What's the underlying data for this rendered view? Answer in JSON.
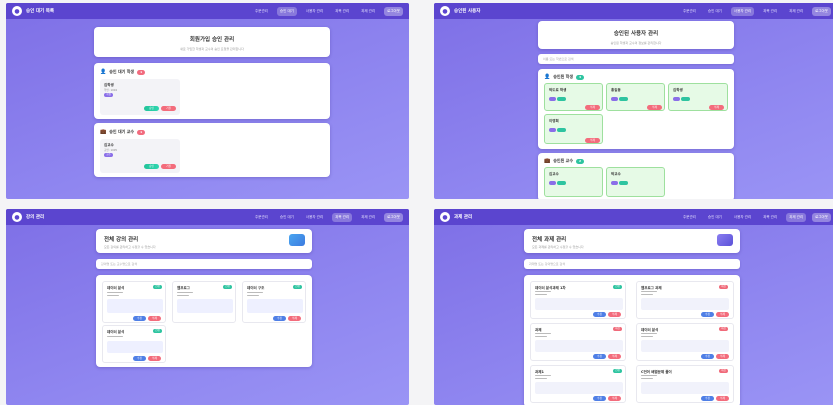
{
  "screens": [
    {
      "brand": "승인 대기 목록",
      "nav": [
        "주문관리",
        "승인 대기",
        "사용자 관리",
        "과목 관리",
        "과제 관리",
        "로그아웃"
      ],
      "active": 1,
      "title": "회원가입 승인 관리",
      "subtitle": "새로 가입한 학생과 교수의 승인 요청을 관리합니다",
      "students_title": "승인 대기 학생",
      "students_count": "1",
      "student_name": "김학생",
      "student_id": "학번: 1004",
      "professors_title": "승인 대기 교수",
      "professors_count": "1",
      "professor_name": "김교수",
      "professor_id": "교번: 1005",
      "role_student": "학생",
      "role_professor": "교수",
      "approve": "승인",
      "reject": "거절"
    },
    {
      "brand": "승인된 사용자",
      "nav": [
        "주문관리",
        "승인 대기",
        "사용자 관리",
        "과목 관리",
        "과제 관리",
        "로그아웃"
      ],
      "active": 2,
      "title": "승인된 사용자 관리",
      "subtitle": "승인된 학생과 교수의 정보를 관리합니다",
      "search_placeholder": "이름 또는 학번으로 검색",
      "students_title": "승인된 학생",
      "students_count": "4",
      "students": [
        "박도로 학생",
        "홍길동",
        "김학생",
        "이영희"
      ],
      "professors_title": "승인된 교수",
      "professors_count": "2",
      "professors": [
        "김교수",
        "박교수"
      ],
      "delete": "삭제"
    },
    {
      "brand": "강의 관리",
      "nav": [
        "주문관리",
        "승인 대기",
        "사용자 관리",
        "과목 관리",
        "과제 관리",
        "로그아웃"
      ],
      "active": 3,
      "title": "전체 강의 관리",
      "subtitle": "모든 강의를 관리하고 수정할 수 있습니다",
      "search_placeholder": "강의명 또는 교수명으로 검색",
      "courses": [
        "데이터 분석",
        "웹프로그",
        "데이터 구조",
        "데이터 분석"
      ],
      "status": "진행",
      "edit": "수정",
      "delete": "삭제"
    },
    {
      "brand": "과제 관리",
      "nav": [
        "주문관리",
        "승인 대기",
        "사용자 관리",
        "과목 관리",
        "과제 관리",
        "로그아웃"
      ],
      "active": 4,
      "title": "전체 과제 관리",
      "subtitle": "모든 과제를 관리하고 수정할 수 있습니다",
      "search_placeholder": "과제명 또는 강의명으로 검색",
      "assignments": [
        "데이터 분석과제 1차",
        "웹프로그 과제",
        "과제",
        "데이터 분석",
        "과제1",
        "C언어 배열문제 풀이"
      ],
      "status_open": "진행",
      "status_closed": "마감",
      "edit": "수정",
      "delete": "삭제"
    }
  ],
  "colors": {
    "nav": "#5b45cf",
    "bg": "#8f86f0",
    "approve": "#2ec4a0",
    "reject": "#f06a7a",
    "edit": "#4f7fe6"
  }
}
